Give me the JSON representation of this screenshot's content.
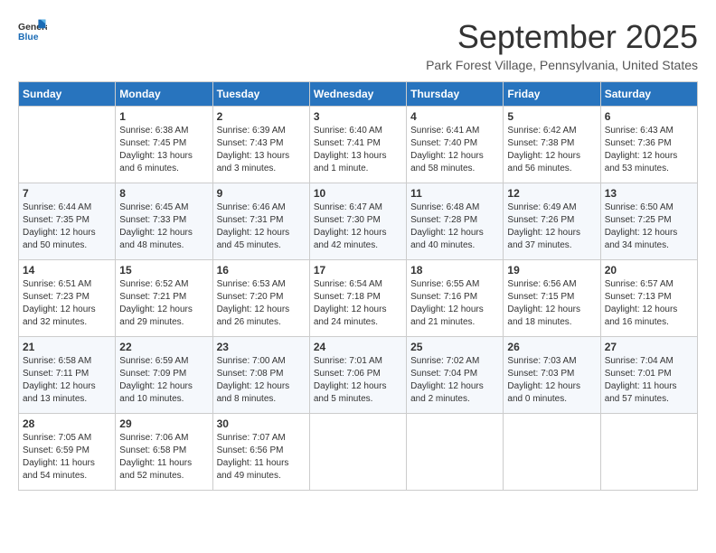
{
  "logo": {
    "text_general": "General",
    "text_blue": "Blue"
  },
  "title": "September 2025",
  "location": "Park Forest Village, Pennsylvania, United States",
  "weekdays": [
    "Sunday",
    "Monday",
    "Tuesday",
    "Wednesday",
    "Thursday",
    "Friday",
    "Saturday"
  ],
  "weeks": [
    [
      {
        "day": "",
        "sunrise": "",
        "sunset": "",
        "daylight": ""
      },
      {
        "day": "1",
        "sunrise": "Sunrise: 6:38 AM",
        "sunset": "Sunset: 7:45 PM",
        "daylight": "Daylight: 13 hours and 6 minutes."
      },
      {
        "day": "2",
        "sunrise": "Sunrise: 6:39 AM",
        "sunset": "Sunset: 7:43 PM",
        "daylight": "Daylight: 13 hours and 3 minutes."
      },
      {
        "day": "3",
        "sunrise": "Sunrise: 6:40 AM",
        "sunset": "Sunset: 7:41 PM",
        "daylight": "Daylight: 13 hours and 1 minute."
      },
      {
        "day": "4",
        "sunrise": "Sunrise: 6:41 AM",
        "sunset": "Sunset: 7:40 PM",
        "daylight": "Daylight: 12 hours and 58 minutes."
      },
      {
        "day": "5",
        "sunrise": "Sunrise: 6:42 AM",
        "sunset": "Sunset: 7:38 PM",
        "daylight": "Daylight: 12 hours and 56 minutes."
      },
      {
        "day": "6",
        "sunrise": "Sunrise: 6:43 AM",
        "sunset": "Sunset: 7:36 PM",
        "daylight": "Daylight: 12 hours and 53 minutes."
      }
    ],
    [
      {
        "day": "7",
        "sunrise": "Sunrise: 6:44 AM",
        "sunset": "Sunset: 7:35 PM",
        "daylight": "Daylight: 12 hours and 50 minutes."
      },
      {
        "day": "8",
        "sunrise": "Sunrise: 6:45 AM",
        "sunset": "Sunset: 7:33 PM",
        "daylight": "Daylight: 12 hours and 48 minutes."
      },
      {
        "day": "9",
        "sunrise": "Sunrise: 6:46 AM",
        "sunset": "Sunset: 7:31 PM",
        "daylight": "Daylight: 12 hours and 45 minutes."
      },
      {
        "day": "10",
        "sunrise": "Sunrise: 6:47 AM",
        "sunset": "Sunset: 7:30 PM",
        "daylight": "Daylight: 12 hours and 42 minutes."
      },
      {
        "day": "11",
        "sunrise": "Sunrise: 6:48 AM",
        "sunset": "Sunset: 7:28 PM",
        "daylight": "Daylight: 12 hours and 40 minutes."
      },
      {
        "day": "12",
        "sunrise": "Sunrise: 6:49 AM",
        "sunset": "Sunset: 7:26 PM",
        "daylight": "Daylight: 12 hours and 37 minutes."
      },
      {
        "day": "13",
        "sunrise": "Sunrise: 6:50 AM",
        "sunset": "Sunset: 7:25 PM",
        "daylight": "Daylight: 12 hours and 34 minutes."
      }
    ],
    [
      {
        "day": "14",
        "sunrise": "Sunrise: 6:51 AM",
        "sunset": "Sunset: 7:23 PM",
        "daylight": "Daylight: 12 hours and 32 minutes."
      },
      {
        "day": "15",
        "sunrise": "Sunrise: 6:52 AM",
        "sunset": "Sunset: 7:21 PM",
        "daylight": "Daylight: 12 hours and 29 minutes."
      },
      {
        "day": "16",
        "sunrise": "Sunrise: 6:53 AM",
        "sunset": "Sunset: 7:20 PM",
        "daylight": "Daylight: 12 hours and 26 minutes."
      },
      {
        "day": "17",
        "sunrise": "Sunrise: 6:54 AM",
        "sunset": "Sunset: 7:18 PM",
        "daylight": "Daylight: 12 hours and 24 minutes."
      },
      {
        "day": "18",
        "sunrise": "Sunrise: 6:55 AM",
        "sunset": "Sunset: 7:16 PM",
        "daylight": "Daylight: 12 hours and 21 minutes."
      },
      {
        "day": "19",
        "sunrise": "Sunrise: 6:56 AM",
        "sunset": "Sunset: 7:15 PM",
        "daylight": "Daylight: 12 hours and 18 minutes."
      },
      {
        "day": "20",
        "sunrise": "Sunrise: 6:57 AM",
        "sunset": "Sunset: 7:13 PM",
        "daylight": "Daylight: 12 hours and 16 minutes."
      }
    ],
    [
      {
        "day": "21",
        "sunrise": "Sunrise: 6:58 AM",
        "sunset": "Sunset: 7:11 PM",
        "daylight": "Daylight: 12 hours and 13 minutes."
      },
      {
        "day": "22",
        "sunrise": "Sunrise: 6:59 AM",
        "sunset": "Sunset: 7:09 PM",
        "daylight": "Daylight: 12 hours and 10 minutes."
      },
      {
        "day": "23",
        "sunrise": "Sunrise: 7:00 AM",
        "sunset": "Sunset: 7:08 PM",
        "daylight": "Daylight: 12 hours and 8 minutes."
      },
      {
        "day": "24",
        "sunrise": "Sunrise: 7:01 AM",
        "sunset": "Sunset: 7:06 PM",
        "daylight": "Daylight: 12 hours and 5 minutes."
      },
      {
        "day": "25",
        "sunrise": "Sunrise: 7:02 AM",
        "sunset": "Sunset: 7:04 PM",
        "daylight": "Daylight: 12 hours and 2 minutes."
      },
      {
        "day": "26",
        "sunrise": "Sunrise: 7:03 AM",
        "sunset": "Sunset: 7:03 PM",
        "daylight": "Daylight: 12 hours and 0 minutes."
      },
      {
        "day": "27",
        "sunrise": "Sunrise: 7:04 AM",
        "sunset": "Sunset: 7:01 PM",
        "daylight": "Daylight: 11 hours and 57 minutes."
      }
    ],
    [
      {
        "day": "28",
        "sunrise": "Sunrise: 7:05 AM",
        "sunset": "Sunset: 6:59 PM",
        "daylight": "Daylight: 11 hours and 54 minutes."
      },
      {
        "day": "29",
        "sunrise": "Sunrise: 7:06 AM",
        "sunset": "Sunset: 6:58 PM",
        "daylight": "Daylight: 11 hours and 52 minutes."
      },
      {
        "day": "30",
        "sunrise": "Sunrise: 7:07 AM",
        "sunset": "Sunset: 6:56 PM",
        "daylight": "Daylight: 11 hours and 49 minutes."
      },
      {
        "day": "",
        "sunrise": "",
        "sunset": "",
        "daylight": ""
      },
      {
        "day": "",
        "sunrise": "",
        "sunset": "",
        "daylight": ""
      },
      {
        "day": "",
        "sunrise": "",
        "sunset": "",
        "daylight": ""
      },
      {
        "day": "",
        "sunrise": "",
        "sunset": "",
        "daylight": ""
      }
    ]
  ]
}
